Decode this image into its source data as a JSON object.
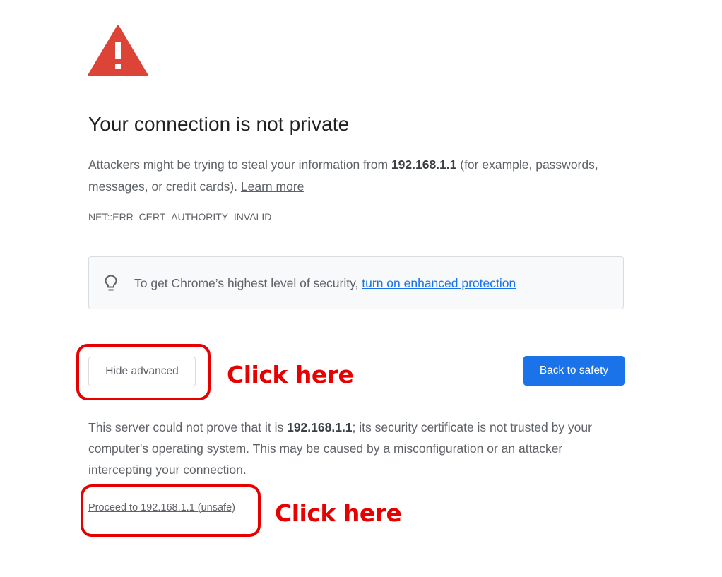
{
  "interstitial": {
    "title": "Your connection is not private",
    "description_prefix": "Attackers might be trying to steal your information from ",
    "host": "192.168.1.1",
    "description_suffix": " (for example, passwords, messages, or credit cards). ",
    "learn_more_label": "Learn more",
    "error_code": "NET::ERR_CERT_AUTHORITY_INVALID",
    "enhanced_protection": {
      "text": "To get Chrome’s highest level of security, ",
      "link_label": "turn on enhanced protection"
    },
    "hide_advanced_label": "Hide advanced",
    "back_to_safety_label": "Back to safety",
    "details_prefix": "This server could not prove that it is ",
    "details_host": "192.168.1.1",
    "details_suffix": "; its security certificate is not trusted by your computer's operating system. This may be caused by a misconfiguration or an attacker intercepting your connection.",
    "proceed_label": "Proceed to 192.168.1.1 (unsafe)"
  },
  "annotations": {
    "label_1": "Click here",
    "label_2": "Click here"
  },
  "colors": {
    "warning_red": "#db4437",
    "primary_blue": "#1a73e8",
    "annotation_red": "#e60000",
    "text_gray": "#5f6368"
  },
  "icons": {
    "warning": "warning-triangle-icon",
    "bulb": "lightbulb-icon"
  }
}
